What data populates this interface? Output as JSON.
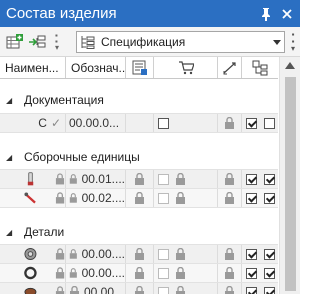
{
  "window": {
    "title": "Состав изделия"
  },
  "toolbar": {
    "view_select": {
      "value": "Спецификация"
    }
  },
  "columns": [
    {
      "label": "Наимен..."
    },
    {
      "label": "Обознач..."
    }
  ],
  "groups": [
    {
      "label": "Документация"
    },
    {
      "label": "Сборочные единицы"
    },
    {
      "label": "Детали"
    }
  ],
  "rows": {
    "doc": [
      {
        "name": "С",
        "designation": "00.00.0..."
      }
    ],
    "assemblies": [
      {
        "designation": "00.01...."
      },
      {
        "designation": "00.02...."
      }
    ],
    "parts": [
      {
        "designation": "00.00...."
      },
      {
        "designation": "00.00...."
      },
      {
        "designation": "00.00..."
      }
    ]
  },
  "colors": {
    "title_bar": "#2b6fc2",
    "row_bg": "#f0f0f0"
  }
}
